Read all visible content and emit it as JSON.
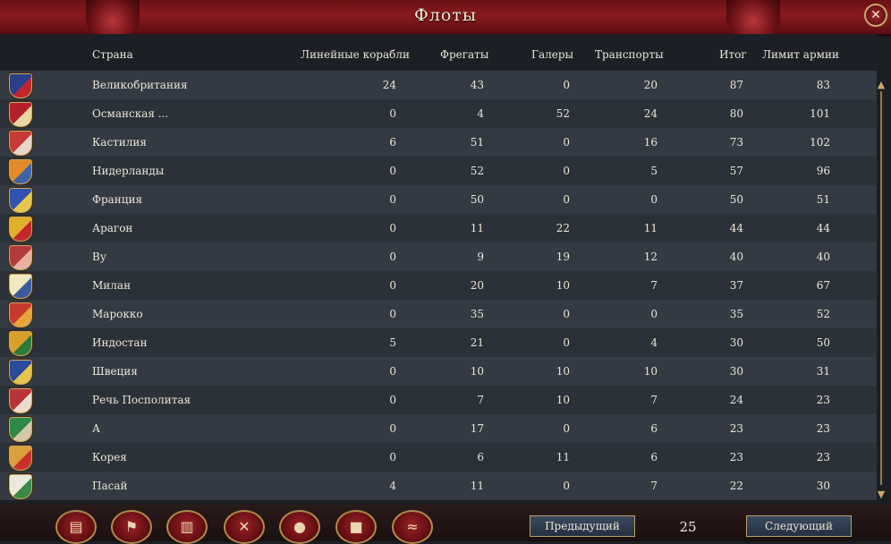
{
  "window": {
    "title": "Флоты",
    "close_icon": "close-icon"
  },
  "columns": {
    "country": "Страна",
    "ships_of_line": "Линейные корабли",
    "frigates": "Фрегаты",
    "galleys": "Галеры",
    "transports": "Транспорты",
    "total": "Итог",
    "limit": "Лимит армии"
  },
  "rows": [
    {
      "country": "Великобритания",
      "ships_of_line": "24",
      "frigates": "43",
      "galleys": "0",
      "transports": "20",
      "total": "87",
      "limit": "83",
      "flag": "#2a3f8a",
      "flag2": "#c4262e"
    },
    {
      "country": "Османская  ...",
      "ships_of_line": "0",
      "frigates": "4",
      "galleys": "52",
      "transports": "24",
      "total": "80",
      "limit": "101",
      "flag": "#b3202a",
      "flag2": "#e9d6a0"
    },
    {
      "country": "Кастилия",
      "ships_of_line": "6",
      "frigates": "51",
      "galleys": "0",
      "transports": "16",
      "total": "73",
      "limit": "102",
      "flag": "#c83a36",
      "flag2": "#e9d6c8"
    },
    {
      "country": "Нидерланды",
      "ships_of_line": "0",
      "frigates": "52",
      "galleys": "0",
      "transports": "5",
      "total": "57",
      "limit": "96",
      "flag": "#e38a2a",
      "flag2": "#3c64a8"
    },
    {
      "country": "Франция",
      "ships_of_line": "0",
      "frigates": "50",
      "galleys": "0",
      "transports": "0",
      "total": "50",
      "limit": "51",
      "flag": "#2e54b0",
      "flag2": "#e7c74c"
    },
    {
      "country": "Арагон",
      "ships_of_line": "0",
      "frigates": "11",
      "galleys": "22",
      "transports": "11",
      "total": "44",
      "limit": "44",
      "flag": "#e0b02a",
      "flag2": "#c3262b"
    },
    {
      "country": "Ву",
      "ships_of_line": "0",
      "frigates": "9",
      "galleys": "19",
      "transports": "12",
      "total": "40",
      "limit": "40",
      "flag": "#b33a3a",
      "flag2": "#e8b0a0"
    },
    {
      "country": "Милан",
      "ships_of_line": "0",
      "frigates": "20",
      "galleys": "10",
      "transports": "7",
      "total": "37",
      "limit": "67",
      "flag": "#f0e9c0",
      "flag2": "#3a5aa0"
    },
    {
      "country": "Марокко",
      "ships_of_line": "0",
      "frigates": "35",
      "galleys": "0",
      "transports": "0",
      "total": "35",
      "limit": "52",
      "flag": "#c83a2e",
      "flag2": "#e6a43a"
    },
    {
      "country": "Индостан",
      "ships_of_line": "5",
      "frigates": "21",
      "galleys": "0",
      "transports": "4",
      "total": "30",
      "limit": "50",
      "flag": "#d8a02a",
      "flag2": "#2e7a3a"
    },
    {
      "country": "Швеция",
      "ships_of_line": "0",
      "frigates": "10",
      "galleys": "10",
      "transports": "10",
      "total": "30",
      "limit": "31",
      "flag": "#2a4a9a",
      "flag2": "#e6c34a"
    },
    {
      "country": "Речь Посполитая",
      "ships_of_line": "0",
      "frigates": "7",
      "galleys": "10",
      "transports": "7",
      "total": "24",
      "limit": "23",
      "flag": "#b8343a",
      "flag2": "#ecdcd0"
    },
    {
      "country": "А",
      "ships_of_line": "0",
      "frigates": "17",
      "galleys": "0",
      "transports": "6",
      "total": "23",
      "limit": "23",
      "flag": "#2f8a4a",
      "flag2": "#d8c8a8"
    },
    {
      "country": "Корея",
      "ships_of_line": "0",
      "frigates": "6",
      "galleys": "11",
      "transports": "6",
      "total": "23",
      "limit": "23",
      "flag": "#d8a03a",
      "flag2": "#c8302e"
    },
    {
      "country": "Пасай",
      "ships_of_line": "4",
      "frigates": "11",
      "galleys": "0",
      "transports": "7",
      "total": "22",
      "limit": "30",
      "flag": "#ece8de",
      "flag2": "#3a8a46"
    }
  ],
  "footer": {
    "icons": [
      "scroll-icon",
      "flag-icon",
      "buildings-icon",
      "crossed-swords-icon",
      "coins-icon",
      "crate-icon",
      "handshake-icon"
    ],
    "prev_label": "Предыдущий",
    "next_label": "Следующий",
    "page": "25"
  }
}
